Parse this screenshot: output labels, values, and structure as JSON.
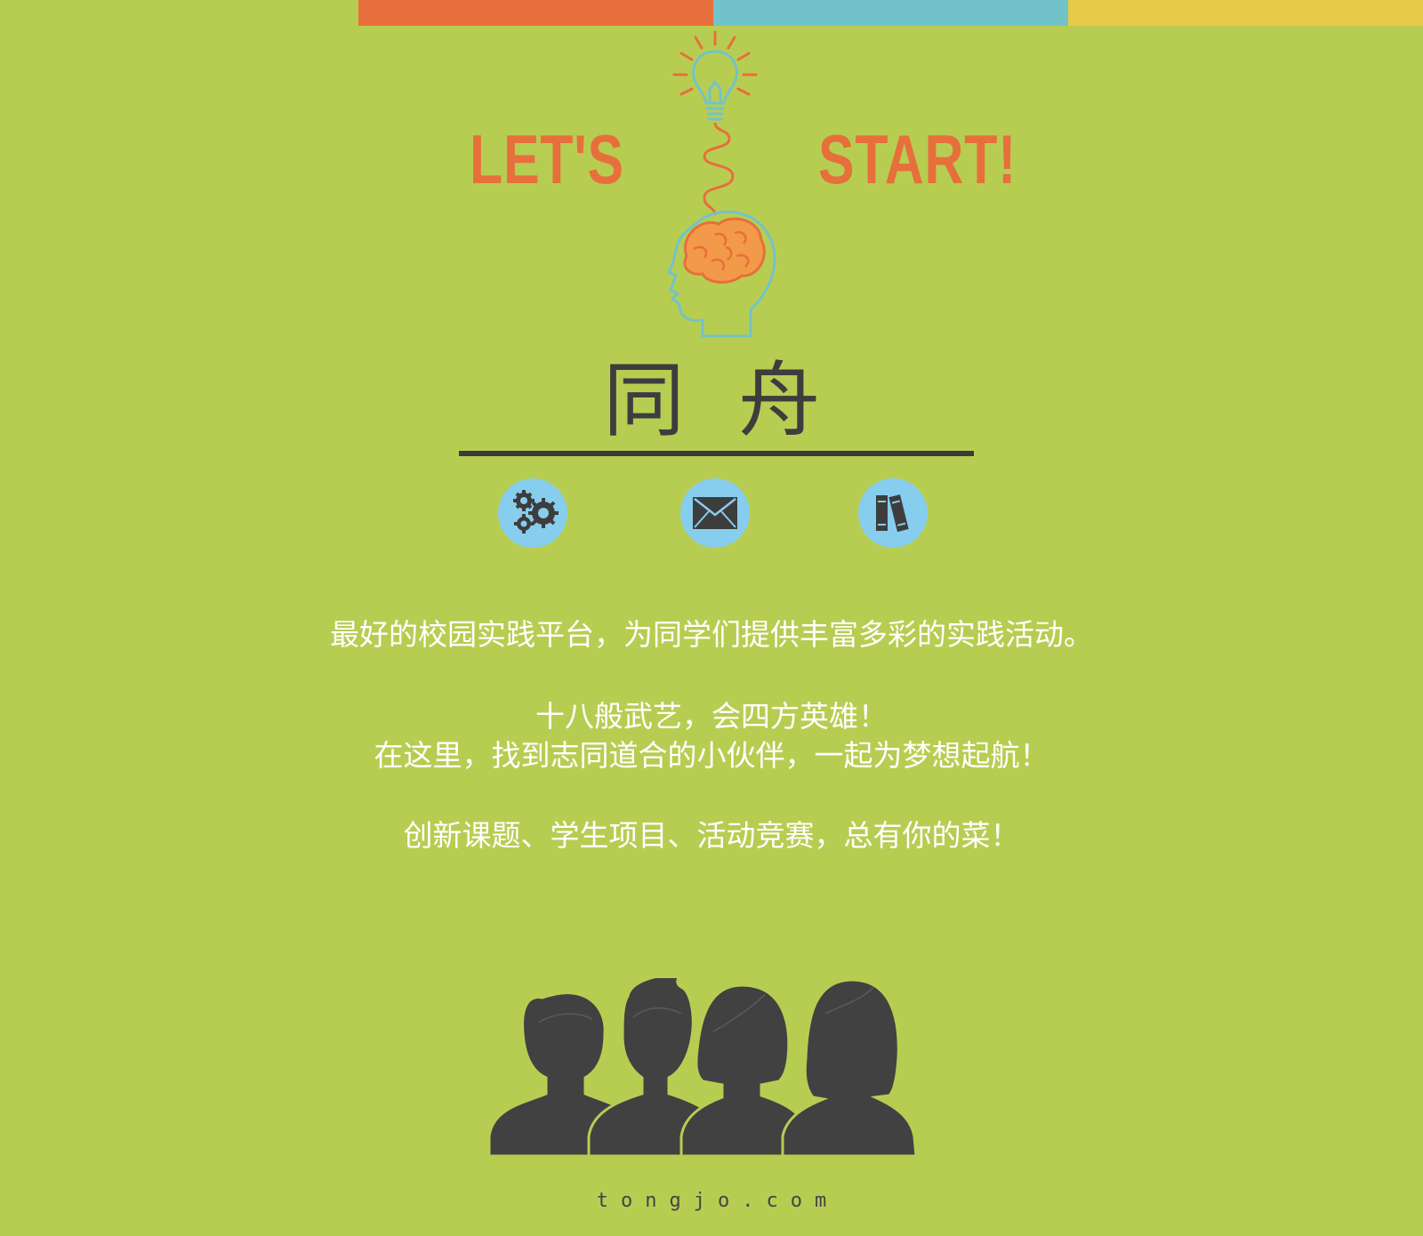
{
  "colors": {
    "background": "#b7cd52",
    "orange": "#e76f3b",
    "blue": "#72c3c9",
    "yellow": "#e8cb49",
    "icon_bg": "#87cdee",
    "dark": "#3d3d3d"
  },
  "top_bar": [
    "#e76f3b",
    "#72c3c9",
    "#e8cb49"
  ],
  "hero": {
    "left_word": "LET'S",
    "right_word": "START!"
  },
  "brand": {
    "title": "同舟"
  },
  "features": [
    {
      "icon": "gears-icon"
    },
    {
      "icon": "envelope-icon"
    },
    {
      "icon": "books-icon"
    }
  ],
  "copy": {
    "line1": "最好的校园实践平台，为同学们提供丰富多彩的实践活动。",
    "line2": "十八般武艺，会四方英雄！",
    "line3": "在这里，找到志同道合的小伙伴，一起为梦想起航！",
    "line4": "创新课题、学生项目、活动竞赛，总有你的菜！"
  },
  "footer": {
    "domain": "tongjo.com"
  }
}
